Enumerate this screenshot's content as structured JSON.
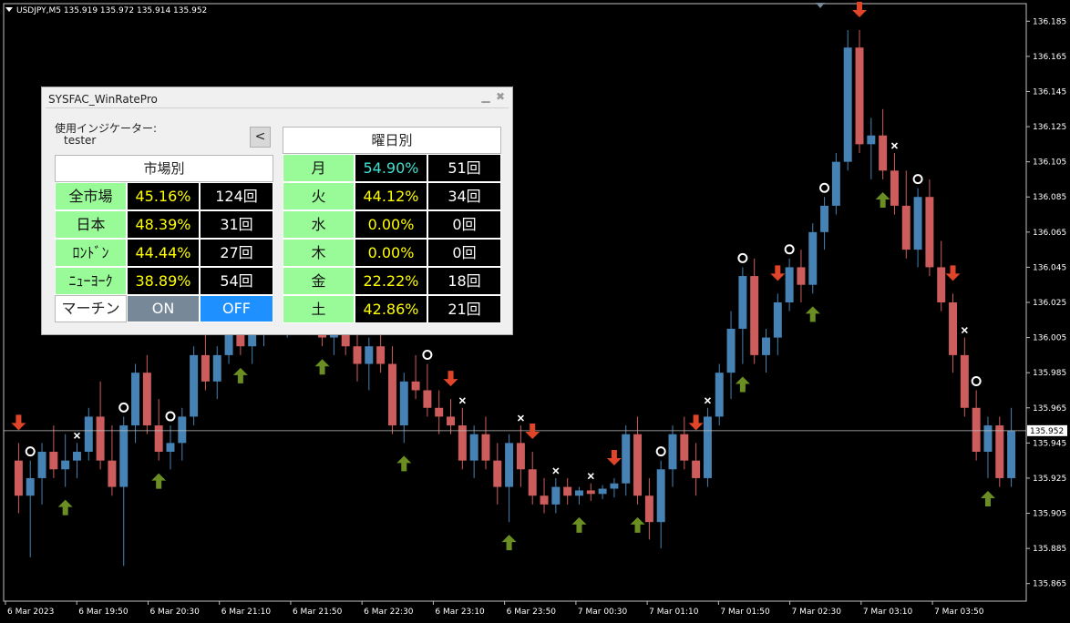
{
  "symbol_info": "USDJPY,M5  135.919 135.972 135.914 135.952",
  "current_price": "135.952",
  "price_axis": [
    "136.185",
    "136.165",
    "136.145",
    "136.125",
    "136.105",
    "136.085",
    "136.065",
    "136.045",
    "136.025",
    "136.005",
    "135.985",
    "135.965",
    "135.945",
    "135.925",
    "135.905",
    "135.885",
    "135.865"
  ],
  "time_axis": [
    "6 Mar 2023",
    "6 Mar 19:50",
    "6 Mar 20:30",
    "6 Mar 21:10",
    "6 Mar 21:50",
    "6 Mar 22:30",
    "6 Mar 23:10",
    "6 Mar 23:50",
    "7 Mar 00:30",
    "7 Mar 01:10",
    "7 Mar 01:50",
    "7 Mar 02:30",
    "7 Mar 03:10",
    "7 Mar 03:50"
  ],
  "colors": {
    "bull": "#4682b4",
    "bear": "#cd5c5c",
    "up_arrow": "#6b8e23",
    "down_arrow": "#e0452a",
    "lime_label": "#98fb98",
    "off_button": "#1e90ff",
    "on_button": "#778899"
  },
  "panel": {
    "title": "SYSFAC_WinRatePro",
    "minimize_icon": "minimize-icon",
    "close_icon": "close-icon",
    "indicator_label": "使用インジケーター:",
    "indicator_value": "tester",
    "back_button": "<",
    "market_header": "市場別",
    "weekday_header": "曜日別",
    "markets": [
      {
        "label": "全市場",
        "pct": "45.16%",
        "count": "124回"
      },
      {
        "label": "日本",
        "pct": "48.39%",
        "count": "31回"
      },
      {
        "label": "ﾛﾝﾄﾞﾝ",
        "pct": "44.44%",
        "count": "27回"
      },
      {
        "label": "ﾆｭｰﾖｰｸ",
        "pct": "38.89%",
        "count": "54回"
      }
    ],
    "martingale": {
      "label": "マーチン",
      "on": "ON",
      "off": "OFF"
    },
    "weekdays": [
      {
        "label": "月",
        "pct": "54.90%",
        "count": "51回",
        "pct_color": "#40e0d0"
      },
      {
        "label": "火",
        "pct": "44.12%",
        "count": "34回",
        "pct_color": "#ffff00"
      },
      {
        "label": "水",
        "pct": "0.00%",
        "count": "0回",
        "pct_color": "#ffff00"
      },
      {
        "label": "木",
        "pct": "0.00%",
        "count": "0回",
        "pct_color": "#ffff00"
      },
      {
        "label": "金",
        "pct": "22.22%",
        "count": "18回",
        "pct_color": "#ffff00"
      },
      {
        "label": "土",
        "pct": "42.86%",
        "count": "21回",
        "pct_color": "#ffff00"
      }
    ]
  },
  "chart_data": {
    "type": "candlestick",
    "symbol": "USDJPY",
    "timeframe": "M5",
    "ylim": [
      135.855,
      136.195
    ],
    "candles": [
      [
        135.935,
        135.945,
        135.905,
        135.915
      ],
      [
        135.915,
        135.935,
        135.88,
        135.925
      ],
      [
        135.925,
        135.945,
        135.91,
        135.94
      ],
      [
        135.94,
        135.955,
        135.925,
        135.93
      ],
      [
        135.93,
        135.95,
        135.92,
        135.935
      ],
      [
        135.935,
        135.945,
        135.925,
        135.94
      ],
      [
        135.94,
        135.965,
        135.935,
        135.96
      ],
      [
        135.96,
        135.98,
        135.93,
        135.935
      ],
      [
        135.935,
        135.955,
        135.915,
        135.92
      ],
      [
        135.92,
        135.96,
        135.875,
        135.955
      ],
      [
        135.955,
        135.99,
        135.945,
        135.985
      ],
      [
        135.985,
        135.995,
        135.95,
        135.955
      ],
      [
        135.955,
        135.97,
        135.935,
        135.94
      ],
      [
        135.94,
        135.955,
        135.93,
        135.945
      ],
      [
        135.945,
        135.965,
        135.935,
        135.96
      ],
      [
        135.96,
        136.0,
        135.955,
        135.995
      ],
      [
        135.995,
        136.01,
        135.975,
        135.98
      ],
      [
        135.98,
        136.0,
        135.97,
        135.995
      ],
      [
        135.995,
        136.02,
        135.99,
        136.015
      ],
      [
        136.015,
        136.025,
        135.995,
        136.0
      ],
      [
        136.0,
        136.02,
        135.99,
        136.015
      ],
      [
        136.015,
        136.03,
        136.0,
        136.025
      ],
      [
        136.025,
        136.04,
        136.01,
        136.015
      ],
      [
        136.015,
        136.03,
        136.005,
        136.02
      ],
      [
        136.02,
        136.035,
        136.01,
        136.03
      ],
      [
        136.03,
        136.04,
        136.015,
        136.02
      ],
      [
        136.02,
        136.03,
        136.0,
        136.005
      ],
      [
        136.005,
        136.02,
        135.995,
        136.015
      ],
      [
        136.015,
        136.025,
        135.995,
        136.0
      ],
      [
        136.0,
        136.01,
        135.98,
        135.99
      ],
      [
        135.99,
        136.005,
        135.975,
        136.0
      ],
      [
        136.0,
        136.015,
        135.985,
        135.99
      ],
      [
        135.99,
        136.0,
        135.95,
        135.955
      ],
      [
        135.955,
        135.985,
        135.945,
        135.98
      ],
      [
        135.98,
        135.995,
        135.97,
        135.975
      ],
      [
        135.975,
        135.99,
        135.96,
        135.965
      ],
      [
        135.965,
        135.975,
        135.95,
        135.96
      ],
      [
        135.96,
        135.97,
        135.95,
        135.955
      ],
      [
        135.955,
        135.965,
        135.93,
        135.935
      ],
      [
        135.935,
        135.955,
        135.925,
        135.95
      ],
      [
        135.95,
        135.96,
        135.93,
        135.935
      ],
      [
        135.935,
        135.945,
        135.91,
        135.92
      ],
      [
        135.92,
        135.95,
        135.9,
        135.945
      ],
      [
        135.945,
        135.955,
        135.92,
        135.93
      ],
      [
        135.93,
        135.94,
        135.91,
        135.915
      ],
      [
        135.915,
        135.925,
        135.905,
        135.91
      ],
      [
        135.91,
        135.925,
        135.905,
        135.92
      ],
      [
        135.92,
        135.925,
        135.91,
        135.915
      ],
      [
        135.915,
        135.92,
        135.91,
        135.918
      ],
      [
        135.918,
        135.922,
        135.912,
        135.916
      ],
      [
        135.916,
        135.921,
        135.913,
        135.919
      ],
      [
        135.919,
        135.925,
        135.914,
        135.922
      ],
      [
        135.922,
        135.955,
        135.915,
        135.95
      ],
      [
        135.95,
        135.96,
        135.91,
        135.915
      ],
      [
        135.915,
        135.925,
        135.89,
        135.9
      ],
      [
        135.9,
        135.935,
        135.885,
        135.93
      ],
      [
        135.93,
        135.955,
        135.92,
        135.95
      ],
      [
        135.95,
        135.96,
        135.93,
        135.935
      ],
      [
        135.935,
        135.945,
        135.915,
        135.925
      ],
      [
        135.925,
        135.965,
        135.92,
        135.96
      ],
      [
        135.96,
        135.99,
        135.955,
        135.985
      ],
      [
        135.985,
        136.02,
        135.97,
        136.01
      ],
      [
        136.01,
        136.045,
        135.99,
        136.04
      ],
      [
        136.04,
        136.05,
        135.99,
        135.995
      ],
      [
        135.995,
        136.01,
        135.985,
        136.005
      ],
      [
        136.005,
        136.03,
        135.995,
        136.025
      ],
      [
        136.025,
        136.05,
        136.02,
        136.045
      ],
      [
        136.045,
        136.055,
        136.025,
        136.035
      ],
      [
        136.035,
        136.07,
        136.03,
        136.065
      ],
      [
        136.065,
        136.085,
        136.055,
        136.08
      ],
      [
        136.08,
        136.11,
        136.075,
        136.105
      ],
      [
        136.105,
        136.18,
        136.1,
        136.17
      ],
      [
        136.17,
        136.18,
        136.11,
        136.115
      ],
      [
        136.115,
        136.13,
        136.095,
        136.12
      ],
      [
        136.12,
        136.135,
        136.095,
        136.1
      ],
      [
        136.1,
        136.11,
        136.075,
        136.08
      ],
      [
        136.08,
        136.1,
        136.05,
        136.055
      ],
      [
        136.055,
        136.09,
        136.045,
        136.085
      ],
      [
        136.085,
        136.095,
        136.04,
        136.045
      ],
      [
        136.045,
        136.06,
        136.02,
        136.025
      ],
      [
        136.025,
        136.03,
        135.985,
        135.995
      ],
      [
        135.995,
        136.005,
        135.96,
        135.965
      ],
      [
        135.965,
        135.975,
        135.935,
        135.94
      ],
      [
        135.94,
        135.96,
        135.925,
        135.955
      ],
      [
        135.955,
        135.96,
        135.92,
        135.925
      ],
      [
        135.925,
        135.965,
        135.92,
        135.952
      ]
    ],
    "markers": [
      {
        "type": "down-arrow",
        "i": 0
      },
      {
        "type": "circle",
        "i": 1
      },
      {
        "type": "up-arrow",
        "i": 4
      },
      {
        "type": "cross",
        "i": 5
      },
      {
        "type": "circle",
        "i": 9
      },
      {
        "type": "up-arrow",
        "i": 12
      },
      {
        "type": "circle",
        "i": 13
      },
      {
        "type": "down-arrow",
        "i": 16
      },
      {
        "type": "up-arrow",
        "i": 19
      },
      {
        "type": "cross",
        "i": 20
      },
      {
        "type": "up-arrow",
        "i": 26
      },
      {
        "type": "circle",
        "i": 31
      },
      {
        "type": "up-arrow",
        "i": 33
      },
      {
        "type": "down-arrow",
        "i": 37
      },
      {
        "type": "circle",
        "i": 35
      },
      {
        "type": "cross",
        "i": 38
      },
      {
        "type": "up-arrow",
        "i": 42
      },
      {
        "type": "cross",
        "i": 43
      },
      {
        "type": "down-arrow",
        "i": 44
      },
      {
        "type": "cross",
        "i": 46
      },
      {
        "type": "up-arrow",
        "i": 48
      },
      {
        "type": "cross",
        "i": 49
      },
      {
        "type": "down-arrow",
        "i": 51
      },
      {
        "type": "up-arrow",
        "i": 53
      },
      {
        "type": "circle",
        "i": 55
      },
      {
        "type": "down-arrow",
        "i": 58
      },
      {
        "type": "cross",
        "i": 59
      },
      {
        "type": "circle",
        "i": 62
      },
      {
        "type": "up-arrow",
        "i": 62
      },
      {
        "type": "down-arrow",
        "i": 65
      },
      {
        "type": "circle",
        "i": 66
      },
      {
        "type": "up-arrow",
        "i": 68
      },
      {
        "type": "circle",
        "i": 69
      },
      {
        "type": "down-arrow",
        "i": 72
      },
      {
        "type": "up-arrow",
        "i": 74
      },
      {
        "type": "cross",
        "i": 75
      },
      {
        "type": "circle",
        "i": 77
      },
      {
        "type": "down-arrow",
        "i": 80
      },
      {
        "type": "cross",
        "i": 81
      },
      {
        "type": "circle",
        "i": 82
      },
      {
        "type": "up-arrow",
        "i": 83
      }
    ]
  }
}
